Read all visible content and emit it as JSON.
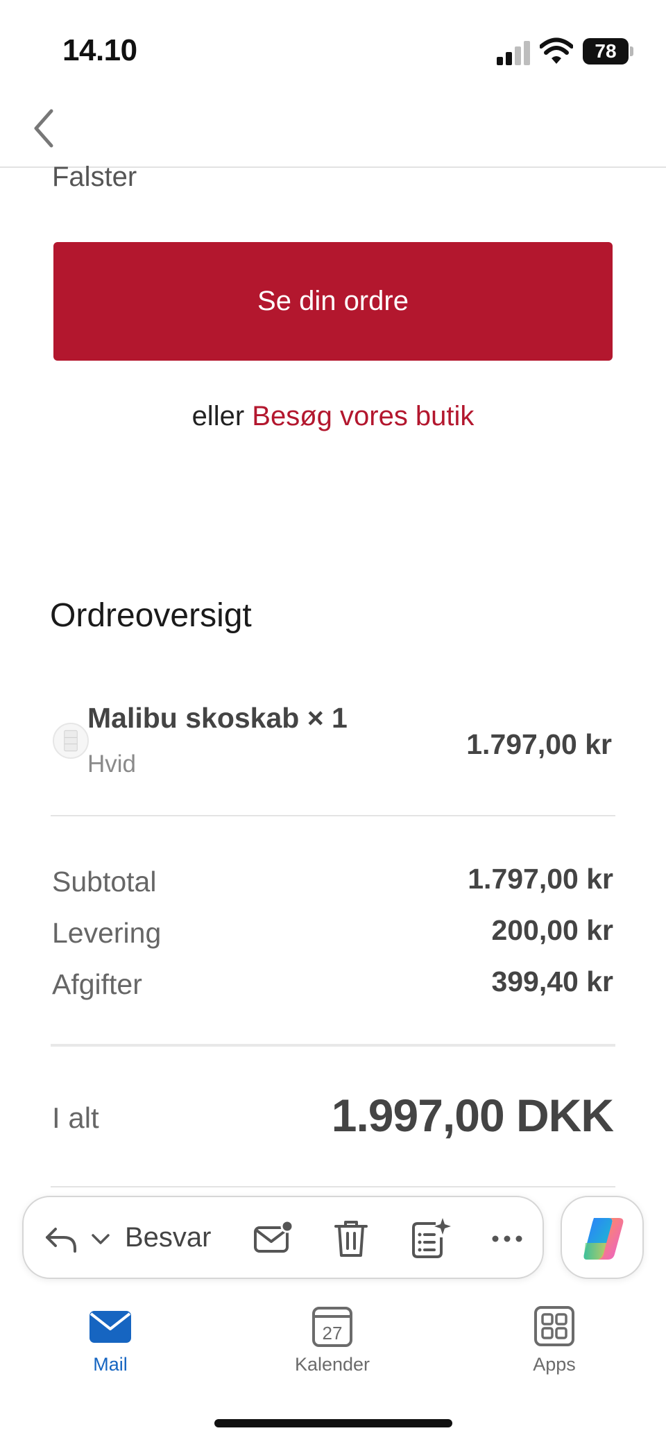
{
  "status_bar": {
    "time": "14.10",
    "battery_level": "78"
  },
  "email_body": {
    "store_name": "Falster",
    "cta_label": "Se din ordre",
    "alt_prefix": "eller",
    "alt_link": "Besøg vores butik",
    "order_title": "Ordreoversigt",
    "item": {
      "name": "Malibu skoskab × 1",
      "variant": "Hvid",
      "price": "1.797,00 kr"
    },
    "summary": [
      {
        "label": "Subtotal",
        "value": "1.797,00 kr"
      },
      {
        "label": "Levering",
        "value": "200,00 kr"
      },
      {
        "label": "Afgifter",
        "value": "399,40 kr"
      }
    ],
    "total": {
      "label": "I alt",
      "value": "1.997,00 DKK"
    }
  },
  "action_bar": {
    "reply_label": "Besvar",
    "icons": [
      "reply-icon",
      "chevron-down-icon",
      "mark-unread-icon",
      "trash-icon",
      "summarize-icon",
      "more-icon",
      "copilot-icon"
    ]
  },
  "tab_bar": {
    "tabs": [
      {
        "label": "Mail",
        "icon": "mail-icon",
        "active": true
      },
      {
        "label": "Kalender",
        "icon": "calendar-icon",
        "day": "27",
        "active": false
      },
      {
        "label": "Apps",
        "icon": "apps-grid-icon",
        "active": false
      }
    ]
  },
  "colors": {
    "brand_red": "#b3172e",
    "active_blue": "#1665c1"
  }
}
